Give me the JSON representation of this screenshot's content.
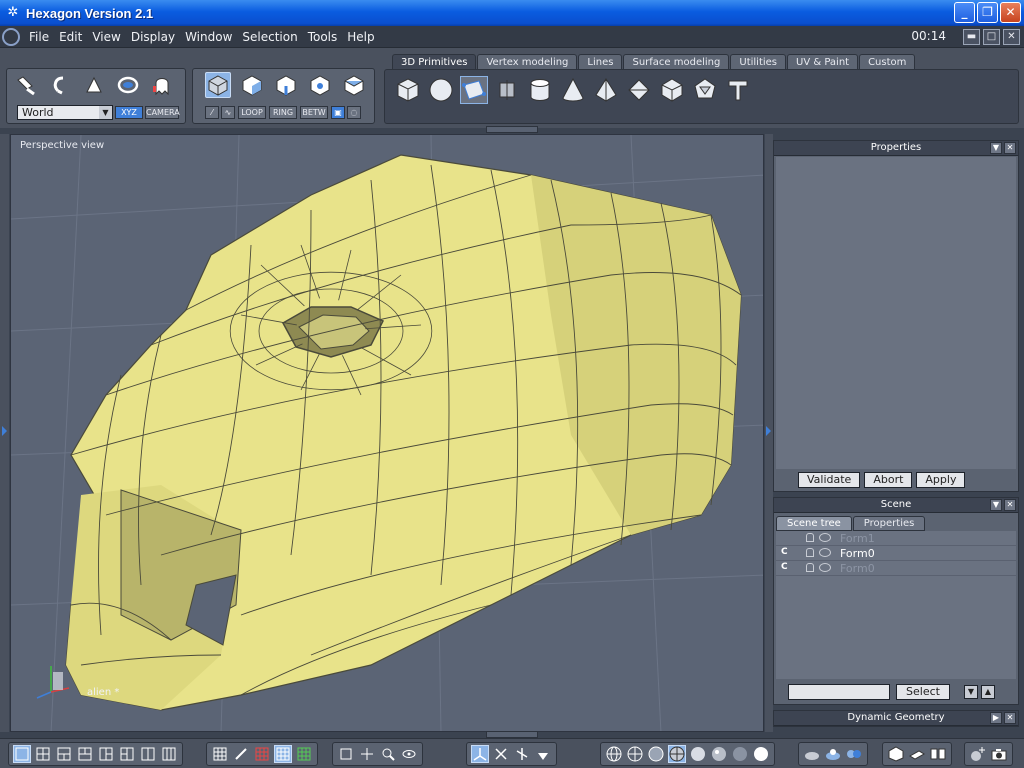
{
  "window": {
    "title": "Hexagon Version 2.1"
  },
  "menu": {
    "items": [
      "File",
      "Edit",
      "View",
      "Display",
      "Window",
      "Selection",
      "Tools",
      "Help"
    ],
    "clock": "00:14"
  },
  "toolbar": {
    "coordinate_space": "World",
    "xyz_label": "XYZ",
    "camera_label": "CAMERA",
    "loop_label": "LOOP",
    "ring_label": "RING",
    "betw_label": "BETW"
  },
  "tabs": [
    "3D Primitives",
    "Vertex modeling",
    "Lines",
    "Surface modeling",
    "Utilities",
    "UV & Paint",
    "Custom"
  ],
  "active_tab": "3D Primitives",
  "viewport": {
    "label": "Perspective view",
    "object_label": "alien *"
  },
  "properties_panel": {
    "title": "Properties",
    "buttons": {
      "validate": "Validate",
      "abort": "Abort",
      "apply": "Apply"
    }
  },
  "scene_panel": {
    "title": "Scene",
    "tabs": [
      "Scene tree",
      "Properties"
    ],
    "rows": [
      {
        "name": "Form1",
        "c": ""
      },
      {
        "name": "Form0",
        "c": "C"
      },
      {
        "name": "Form0",
        "c": "C"
      }
    ],
    "select_label": "Select"
  },
  "dynamic_geometry_panel": {
    "title": "Dynamic Geometry"
  },
  "colors": {
    "mesh_fill": "#e8e38a",
    "mesh_edge": "#4a4a3a",
    "viewport_bg": "#5b6475",
    "title_bar": "#0a5ce0",
    "accent": "#3f7fd8"
  }
}
